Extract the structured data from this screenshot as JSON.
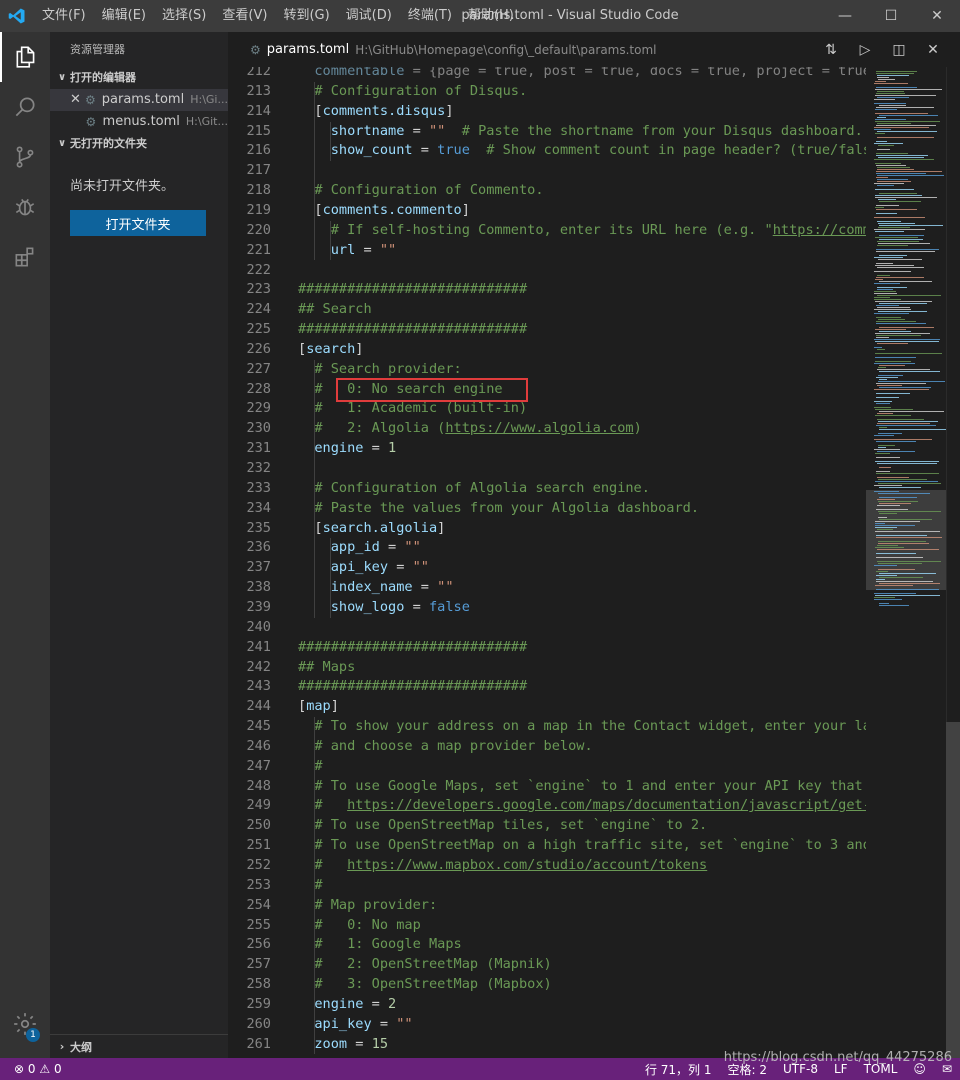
{
  "titlebar": {
    "menus": [
      "文件(F)",
      "编辑(E)",
      "选择(S)",
      "查看(V)",
      "转到(G)",
      "调试(D)",
      "终端(T)",
      "帮助(H)"
    ],
    "title": "params.toml - Visual Studio Code"
  },
  "sidebar": {
    "title": "资源管理器",
    "open_editors_label": "打开的编辑器",
    "open_editors": [
      {
        "name": "params.toml",
        "path": "H:\\Gi..."
      },
      {
        "name": "menus.toml",
        "path": "H:\\Git..."
      }
    ],
    "no_folder_label": "无打开的文件夹",
    "no_folder_message": "尚未打开文件夹。",
    "open_folder_button": "打开文件夹",
    "outline_label": "大纲"
  },
  "tab": {
    "name": "params.toml",
    "path": "H:\\GitHub\\Homepage\\config\\_default\\params.toml"
  },
  "editor": {
    "first_line_number": 212,
    "lines": [
      {
        "n": "212",
        "t": "  commentable = {page = true, post = true, docs = true, project = true, ..."
      },
      {
        "n": "213",
        "t": "  # Configuration of Disqus."
      },
      {
        "n": "214",
        "t": "  [comments.disqus]"
      },
      {
        "n": "215",
        "t": "    shortname = \"\"  # Paste the shortname from your Disqus dashboard."
      },
      {
        "n": "216",
        "t": "    show_count = true  # Show comment count in page header? (true/false"
      },
      {
        "n": "217",
        "t": ""
      },
      {
        "n": "218",
        "t": "  # Configuration of Commento."
      },
      {
        "n": "219",
        "t": "  [comments.commento]"
      },
      {
        "n": "220",
        "t": "    # If self-hosting Commento, enter its URL here (e.g. \"https://comme"
      },
      {
        "n": "221",
        "t": "    url = \"\""
      },
      {
        "n": "222",
        "t": ""
      },
      {
        "n": "223",
        "t": "############################"
      },
      {
        "n": "224",
        "t": "## Search"
      },
      {
        "n": "225",
        "t": "############################"
      },
      {
        "n": "226",
        "t": "[search]"
      },
      {
        "n": "227",
        "t": "  # Search provider:"
      },
      {
        "n": "228",
        "t": "  #   0: No search engine"
      },
      {
        "n": "229",
        "t": "  #   1: Academic (built-in)"
      },
      {
        "n": "230",
        "t": "  #   2: Algolia (https://www.algolia.com)"
      },
      {
        "n": "231",
        "t": "  engine = 1"
      },
      {
        "n": "232",
        "t": ""
      },
      {
        "n": "233",
        "t": "  # Configuration of Algolia search engine."
      },
      {
        "n": "234",
        "t": "  # Paste the values from your Algolia dashboard."
      },
      {
        "n": "235",
        "t": "  [search.algolia]"
      },
      {
        "n": "236",
        "t": "    app_id = \"\""
      },
      {
        "n": "237",
        "t": "    api_key = \"\""
      },
      {
        "n": "238",
        "t": "    index_name = \"\""
      },
      {
        "n": "239",
        "t": "    show_logo = false"
      },
      {
        "n": "240",
        "t": ""
      },
      {
        "n": "241",
        "t": "############################"
      },
      {
        "n": "242",
        "t": "## Maps"
      },
      {
        "n": "243",
        "t": "############################"
      },
      {
        "n": "244",
        "t": "[map]"
      },
      {
        "n": "245",
        "t": "  # To show your address on a map in the Contact widget, enter your lat"
      },
      {
        "n": "246",
        "t": "  # and choose a map provider below."
      },
      {
        "n": "247",
        "t": "  #"
      },
      {
        "n": "248",
        "t": "  # To use Google Maps, set `engine` to 1 and enter your API key that c"
      },
      {
        "n": "249",
        "t": "  #   https://developers.google.com/maps/documentation/javascript/get-a"
      },
      {
        "n": "250",
        "t": "  # To use OpenStreetMap tiles, set `engine` to 2."
      },
      {
        "n": "251",
        "t": "  # To use OpenStreetMap on a high traffic site, set `engine` to 3 and"
      },
      {
        "n": "252",
        "t": "  #   https://www.mapbox.com/studio/account/tokens"
      },
      {
        "n": "253",
        "t": "  #"
      },
      {
        "n": "254",
        "t": "  # Map provider:"
      },
      {
        "n": "255",
        "t": "  #   0: No map"
      },
      {
        "n": "256",
        "t": "  #   1: Google Maps"
      },
      {
        "n": "257",
        "t": "  #   2: OpenStreetMap (Mapnik)"
      },
      {
        "n": "258",
        "t": "  #   3: OpenStreetMap (Mapbox)"
      },
      {
        "n": "259",
        "t": "  engine = 2"
      },
      {
        "n": "260",
        "t": "  api_key = \"\""
      },
      {
        "n": "261",
        "t": "  zoom = 15"
      }
    ]
  },
  "statusbar": {
    "errors": "0",
    "warnings": "0",
    "position": "行 71，列 1",
    "indent": "空格: 2",
    "encoding": "UTF-8",
    "eol": "LF",
    "language": "TOML",
    "watermark": "https://blog.csdn.net/qq_44275286"
  },
  "colors": {
    "accent": "#0e639c",
    "statusbar": "#68217a",
    "highlight_box": "#e03c3c"
  },
  "icons": [
    "vscode-logo-icon",
    "explorer-icon",
    "search-icon",
    "source-control-icon",
    "debug-icon",
    "extensions-icon",
    "settings-gear-icon",
    "compare-changes-icon",
    "run-icon",
    "split-editor-icon",
    "close-icon"
  ]
}
